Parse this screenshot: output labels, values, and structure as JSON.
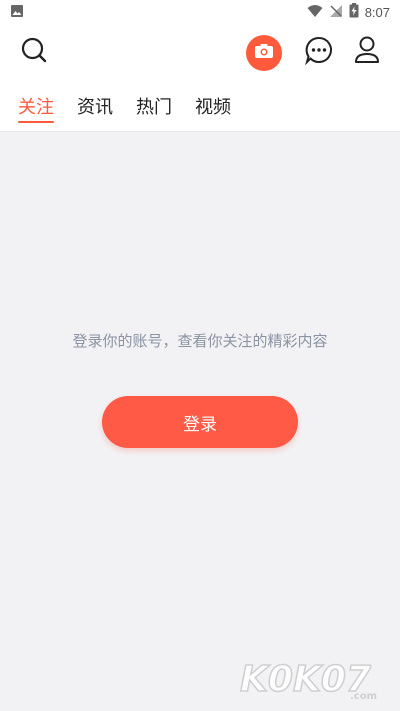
{
  "status_bar": {
    "time": "8:07",
    "icons": [
      "image-icon",
      "wifi-icon",
      "no-signal-icon",
      "battery-charging-icon"
    ]
  },
  "header": {
    "icons": [
      "search-icon",
      "camera-icon",
      "message-icon",
      "user-icon"
    ],
    "camera_bg": "#ff5a3c"
  },
  "tabs": [
    {
      "label": "关注",
      "active": true
    },
    {
      "label": "资讯",
      "active": false
    },
    {
      "label": "热门",
      "active": false
    },
    {
      "label": "视频",
      "active": false
    }
  ],
  "main": {
    "prompt": "登录你的账号，查看你关注的精彩内容",
    "login_label": "登录"
  },
  "watermark": {
    "text": "K0K07.com"
  },
  "colors": {
    "accent": "#ff5a3c",
    "prompt_text": "#8a93a3",
    "background": "#f2f2f4"
  }
}
